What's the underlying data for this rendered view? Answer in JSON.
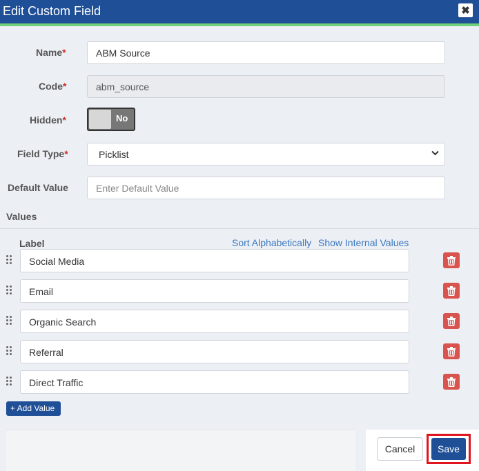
{
  "dialog": {
    "title": "Edit Custom Field",
    "close_label": "✖"
  },
  "form": {
    "name": {
      "label": "Name",
      "required_mark": "*",
      "value": "ABM Source"
    },
    "code": {
      "label": "Code",
      "required_mark": "*",
      "value": "abm_source"
    },
    "hidden": {
      "label": "Hidden",
      "required_mark": "*",
      "state_label": "No",
      "on": false
    },
    "field_type": {
      "label": "Field Type",
      "required_mark": "*",
      "selected": "Picklist"
    },
    "default_value": {
      "label": "Default Value",
      "placeholder": "Enter Default Value",
      "value": ""
    }
  },
  "values": {
    "section_label": "Values",
    "column_label": "Label",
    "sort_link": "Sort Alphabetically",
    "internal_link": "Show Internal Values",
    "items": [
      {
        "label": "Social Media"
      },
      {
        "label": "Email"
      },
      {
        "label": "Organic Search"
      },
      {
        "label": "Referral"
      },
      {
        "label": "Direct Traffic"
      }
    ],
    "add_button": "+ Add Value"
  },
  "footer": {
    "cancel_label": "Cancel",
    "save_label": "Save"
  },
  "colors": {
    "header": "#1f4f96",
    "accent": "#6fcf7a",
    "danger": "#d9534f",
    "highlight": "#e0141e",
    "link": "#3a79c1"
  }
}
